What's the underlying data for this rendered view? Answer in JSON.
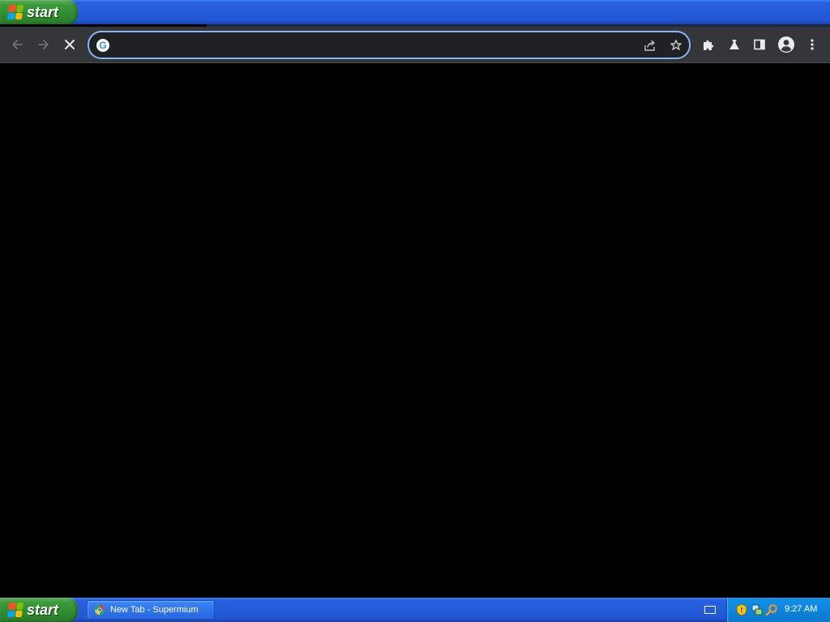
{
  "taskbar_top": {
    "start_label": "start"
  },
  "browser": {
    "omnibox": {
      "value": "",
      "placeholder": ""
    },
    "icons": {
      "back": "arrow-left-icon",
      "forward": "arrow-right-icon",
      "stop": "close-icon",
      "share": "share-icon",
      "bookmark": "star-icon",
      "extensions": "puzzle-icon",
      "labs": "flask-icon",
      "side_panel": "side-panel-icon",
      "profile": "account-icon",
      "menu": "kebab-menu-icon"
    }
  },
  "taskbar_bottom": {
    "start_label": "start",
    "tasks": [
      {
        "label": "New Tab - Supermium"
      }
    ],
    "clock": "9:27 AM"
  },
  "colors": {
    "taskbar_blue": "#245dda",
    "start_green": "#3b9b3b",
    "toolbar": "#35363a",
    "omnibox_border": "#8ab4f8"
  }
}
